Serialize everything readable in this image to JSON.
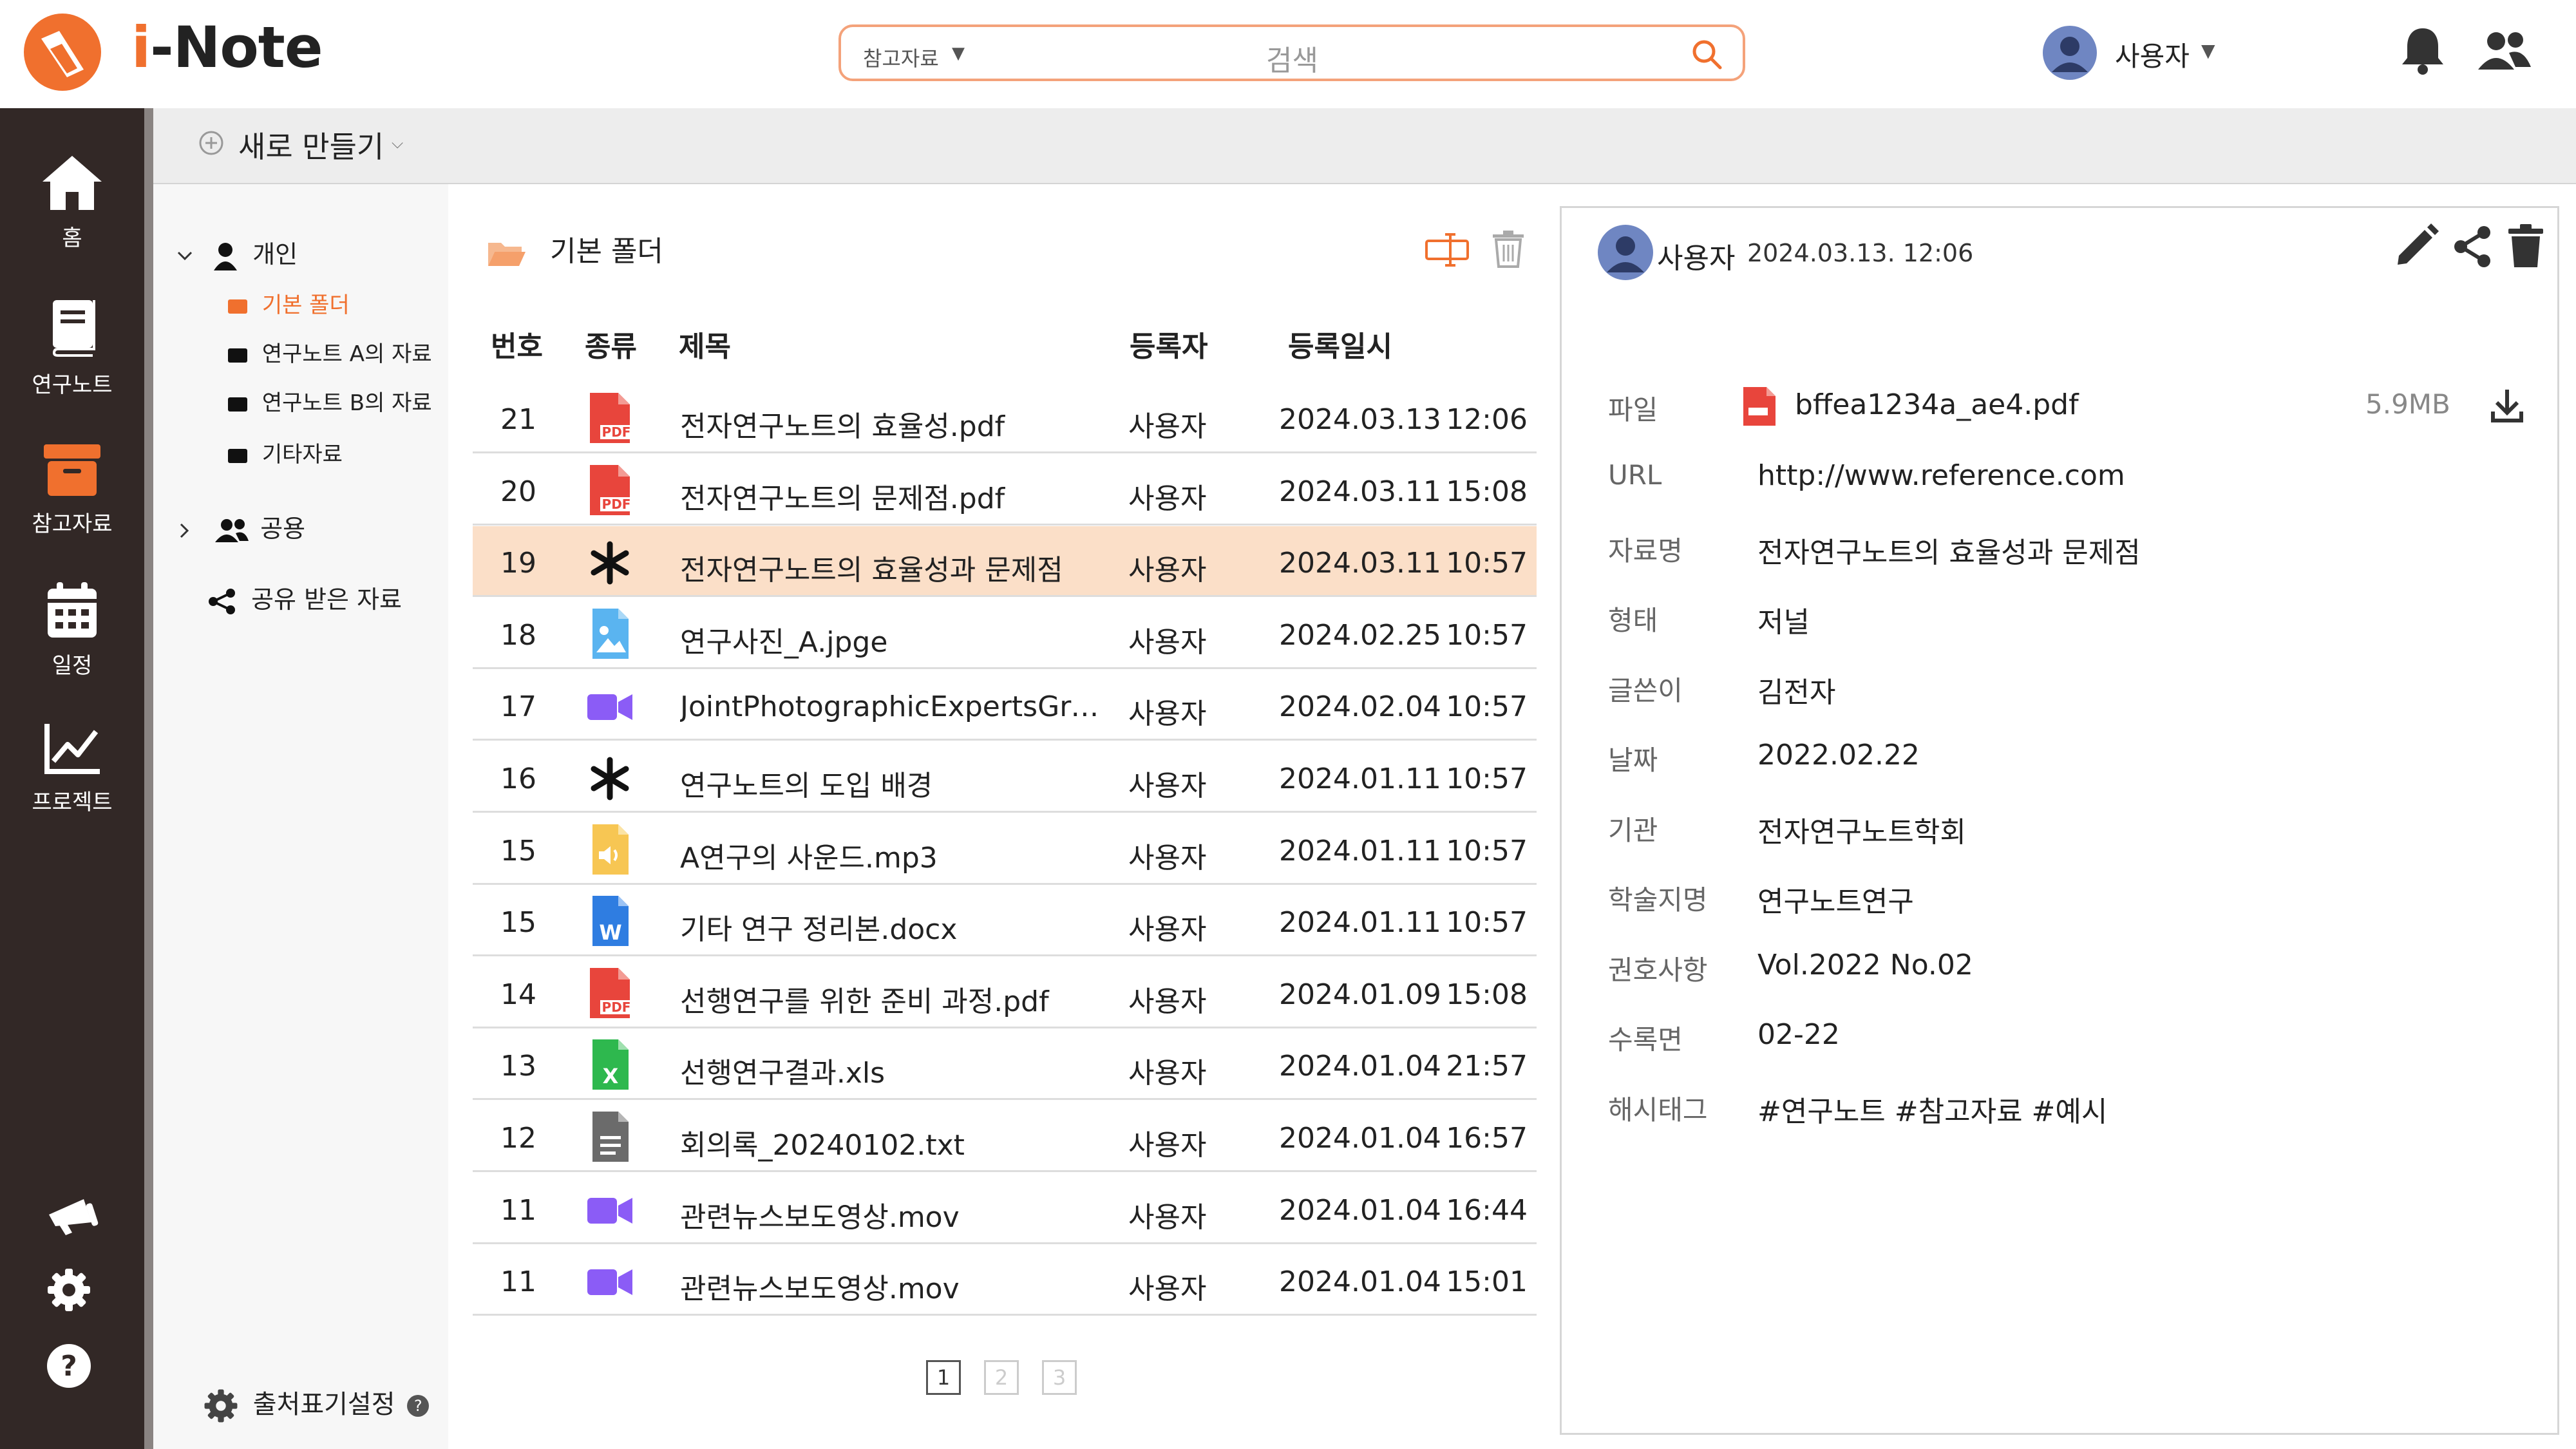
{
  "app": {
    "brand_i": "i",
    "brand_rest": "-Note"
  },
  "search": {
    "category": "참고자료",
    "category_caret": "▼",
    "placeholder": "검색"
  },
  "header_user": {
    "name": "사용자",
    "caret": "▼"
  },
  "nav": [
    {
      "label": "홈",
      "icon": "home-icon"
    },
    {
      "label": "연구노트",
      "icon": "notebook-icon"
    },
    {
      "label": "참고자료",
      "icon": "archive-box-icon"
    },
    {
      "label": "일정",
      "icon": "calendar-icon"
    },
    {
      "label": "프로젝트",
      "icon": "line-chart-icon"
    }
  ],
  "toolbar": {
    "new_label": "새로 만들기",
    "new_caret": "⌵"
  },
  "tree": {
    "personal": "개인",
    "default_folder": "기본 폴더",
    "folder_a": "연구노트 A의 자료",
    "folder_b": "연구노트 B의 자료",
    "folder_other": "기타자료",
    "public": "공용",
    "shared": "공유 받은 자료",
    "citation_settings": "출처표기설정",
    "help_badge": "?"
  },
  "list": {
    "folder_title": "기본 폴더",
    "columns": {
      "no": "번호",
      "type": "종류",
      "title": "제목",
      "author": "등록자",
      "date": "등록일시"
    },
    "rows": [
      {
        "no": "21",
        "type": "pdf",
        "title": "전자연구노트의 효율성.pdf",
        "author": "사용자",
        "date": "2024.03.13",
        "time": "12:06",
        "selected": false
      },
      {
        "no": "20",
        "type": "pdf",
        "title": "전자연구노트의 문제점.pdf",
        "author": "사용자",
        "date": "2024.03.11",
        "time": "15:08",
        "selected": false
      },
      {
        "no": "19",
        "type": "asterisk",
        "title": "전자연구노트의 효율성과 문제점",
        "author": "사용자",
        "date": "2024.03.11",
        "time": "10:57",
        "selected": true
      },
      {
        "no": "18",
        "type": "image",
        "title": "연구사진_A.jpge",
        "author": "사용자",
        "date": "2024.02.25",
        "time": "10:57",
        "selected": false
      },
      {
        "no": "17",
        "type": "video",
        "title": "JointPhotographicExpertsGrou…",
        "author": "사용자",
        "date": "2024.02.04",
        "time": "10:57",
        "selected": false
      },
      {
        "no": "16",
        "type": "asterisk",
        "title": "연구노트의 도입 배경",
        "author": "사용자",
        "date": "2024.01.11",
        "time": "10:57",
        "selected": false
      },
      {
        "no": "15",
        "type": "audio",
        "title": "A연구의 사운드.mp3",
        "author": "사용자",
        "date": "2024.01.11",
        "time": "10:57",
        "selected": false
      },
      {
        "no": "15",
        "type": "word",
        "title": "기타 연구 정리본.docx",
        "author": "사용자",
        "date": "2024.01.11",
        "time": "10:57",
        "selected": false
      },
      {
        "no": "14",
        "type": "pdf",
        "title": "선행연구를 위한 준비 과정.pdf",
        "author": "사용자",
        "date": "2024.01.09",
        "time": "15:08",
        "selected": false
      },
      {
        "no": "13",
        "type": "excel",
        "title": "선행연구결과.xls",
        "author": "사용자",
        "date": "2024.01.04",
        "time": "21:57",
        "selected": false
      },
      {
        "no": "12",
        "type": "text",
        "title": "회의록_20240102.txt",
        "author": "사용자",
        "date": "2024.01.04",
        "time": "16:57",
        "selected": false
      },
      {
        "no": "11",
        "type": "video",
        "title": "관련뉴스보도영상.mov",
        "author": "사용자",
        "date": "2024.01.04",
        "time": "16:44",
        "selected": false
      },
      {
        "no": "11",
        "type": "video",
        "title": "관련뉴스보도영상.mov",
        "author": "사용자",
        "date": "2024.01.04",
        "time": "15:01",
        "selected": false
      }
    ],
    "pages": [
      "1",
      "2",
      "3"
    ],
    "current_page": "1"
  },
  "detail": {
    "user": "사용자",
    "datetime": "2024.03.13. 12:06",
    "file_label": "파일",
    "file_name": "bffea1234a_ae4.pdf",
    "file_size": "5.9MB",
    "fields": [
      {
        "key": "URL",
        "value": "http://www.reference.com"
      },
      {
        "key": "자료명",
        "value": "전자연구노트의 효율성과 문제점"
      },
      {
        "key": "형태",
        "value": "저널"
      },
      {
        "key": "글쓴이",
        "value": "김전자"
      },
      {
        "key": "날짜",
        "value": "2022.02.22"
      },
      {
        "key": "기관",
        "value": "전자연구노트학회"
      },
      {
        "key": "학술지명",
        "value": "연구노트연구"
      },
      {
        "key": "권호사항",
        "value": "Vol.2022 No.02"
      },
      {
        "key": "수록면",
        "value": "02-22"
      },
      {
        "key": "해시태그",
        "value": "#연구노트 #참고자료 #예시"
      }
    ]
  },
  "colors": {
    "accent": "#f0702e",
    "nav_bg": "#322826",
    "selected_row": "#fbdfc8",
    "pdf_red": "#e8453c",
    "video_purple": "#8b5cf6",
    "image_blue": "#5ab4f0",
    "audio_yellow": "#f7c653",
    "word_blue": "#2f7de1",
    "excel_green": "#2eb84e",
    "text_gray": "#6b6b6b"
  }
}
